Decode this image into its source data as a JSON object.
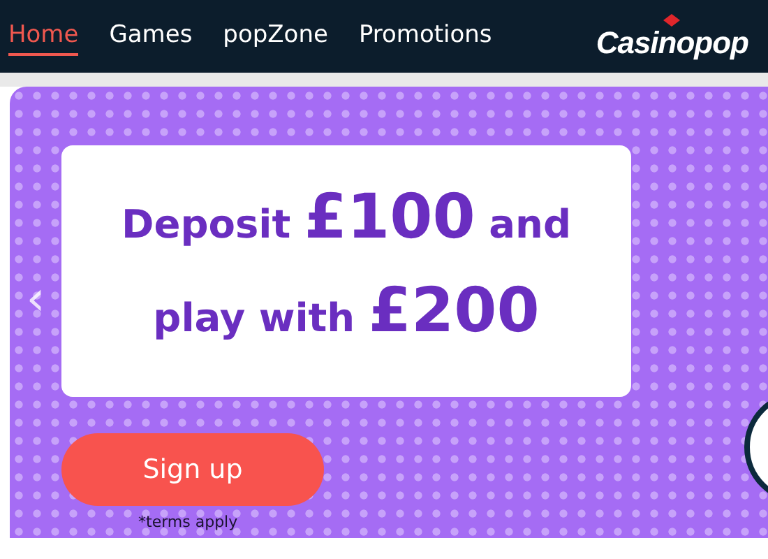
{
  "nav": {
    "items": [
      {
        "label": "Home",
        "selected": true
      },
      {
        "label": "Games",
        "selected": false
      },
      {
        "label": "popZone",
        "selected": false
      },
      {
        "label": "Promotions",
        "selected": false
      }
    ],
    "logo": "Casinopop"
  },
  "banner": {
    "headline": [
      [
        {
          "text": "Deposit ",
          "emphasis": false
        },
        {
          "text": "£100",
          "emphasis": true
        },
        {
          "text": " and",
          "emphasis": false
        }
      ],
      [
        {
          "text": "play with ",
          "emphasis": false
        },
        {
          "text": "£200",
          "emphasis": true
        }
      ]
    ],
    "prev": "‹",
    "button": "Sign up",
    "terms": "*terms apply"
  }
}
